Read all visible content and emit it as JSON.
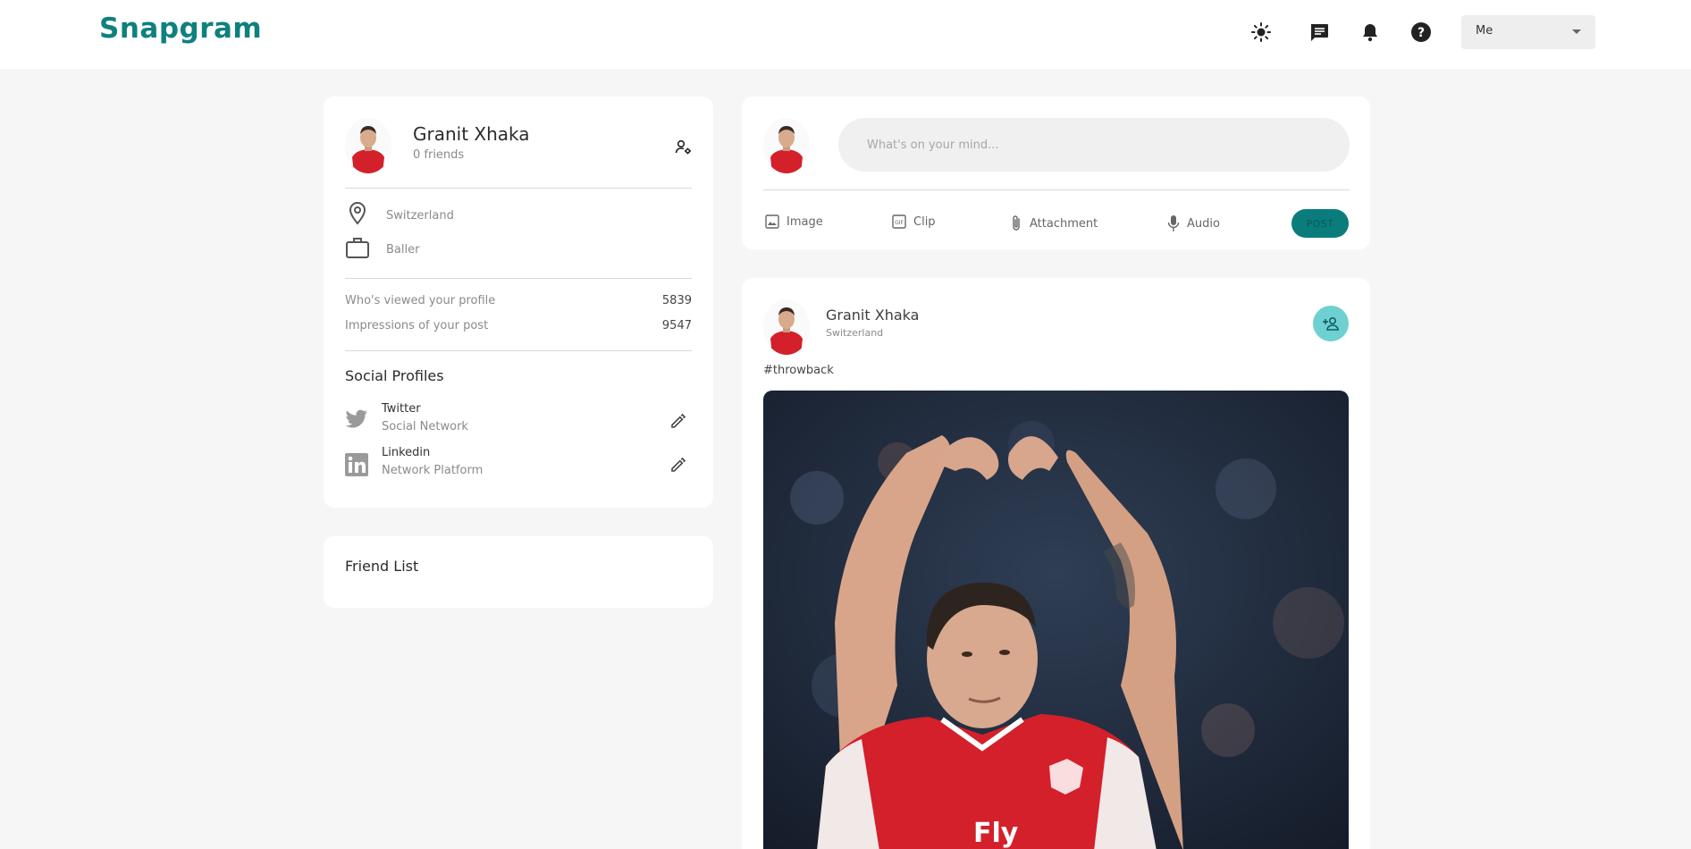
{
  "app": {
    "logo": "Snapgram"
  },
  "navbar": {
    "icons": [
      "sun-icon",
      "message-icon",
      "bell-icon",
      "help-icon"
    ],
    "user_select": {
      "value": "Me"
    }
  },
  "profile": {
    "name": "Granit Xhaka",
    "friends": "0 friends",
    "location": "Switzerland",
    "occupation": "Baller",
    "stats": [
      {
        "label": "Who's viewed your profile",
        "value": "5839"
      },
      {
        "label": "Impressions of your post",
        "value": "9547"
      }
    ],
    "social_title": "Social Profiles",
    "socials": [
      {
        "name": "Twitter",
        "subtitle": "Social Network"
      },
      {
        "name": "Linkedin",
        "subtitle": "Network Platform"
      }
    ]
  },
  "friend_list": {
    "title": "Friend List"
  },
  "composer": {
    "placeholder": "What's on your mind...",
    "actions": [
      "Image",
      "Clip",
      "Attachment",
      "Audio"
    ],
    "post_label": "POST"
  },
  "post": {
    "author": "Granit Xhaka",
    "location": "Switzerland",
    "description": "#throwback"
  },
  "colors": {
    "brand": "#0f8080",
    "post_button": "#0a7c7c",
    "add_friend_button": "#6fd0d1",
    "background": "#f6f6f6"
  }
}
